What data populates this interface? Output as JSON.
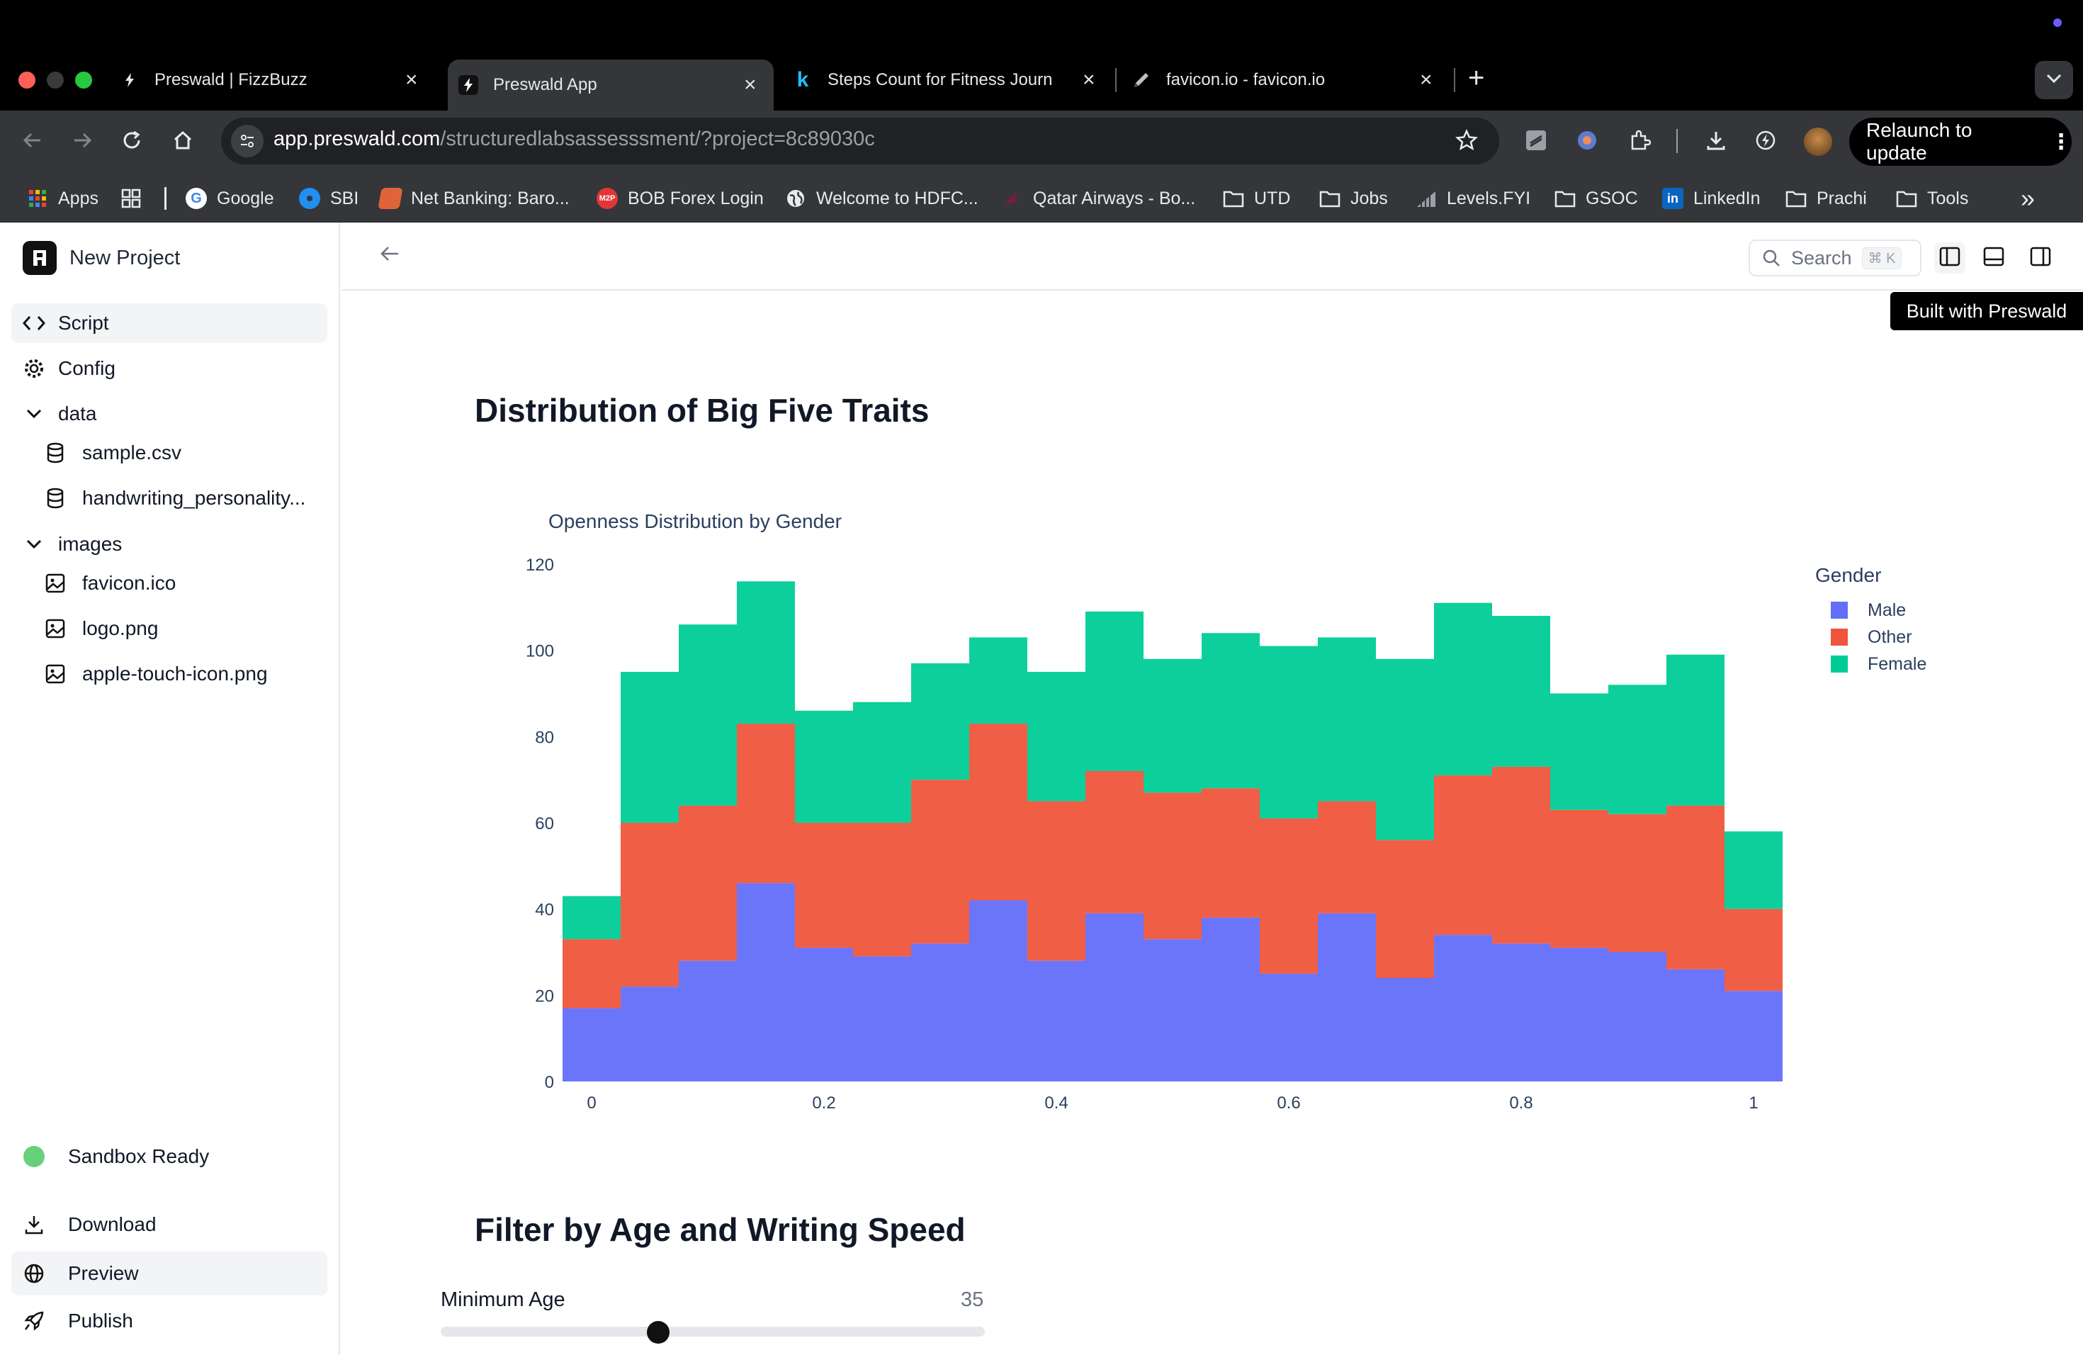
{
  "browser": {
    "tabs": [
      {
        "title": "Preswald | FizzBuzz",
        "icon": "preswald-icon",
        "active": false
      },
      {
        "title": "Preswald App",
        "icon": "preswald-icon",
        "active": true
      },
      {
        "title": "Steps Count for Fitness Journ",
        "icon": "k-icon",
        "active": false
      },
      {
        "title": "favicon.io - favicon.io",
        "icon": "pen-icon",
        "active": false
      }
    ],
    "new_tab_symbol": "+",
    "url_host": "app.preswald.com",
    "url_path": "/structuredlabsassesssment/?project=8c89030c",
    "relaunch_label": "Relaunch to update",
    "bookmarks": [
      {
        "label": "Apps",
        "icon": "apps-grid-icon"
      },
      {
        "label": "",
        "icon": "tab-grid-icon"
      },
      {
        "label": "Google",
        "icon": "google-icon"
      },
      {
        "label": "SBI",
        "icon": "sbi-icon"
      },
      {
        "label": "Net Banking: Baro...",
        "icon": "bank-icon"
      },
      {
        "label": "BOB Forex Login",
        "icon": "m2p-icon"
      },
      {
        "label": "Welcome to HDFC...",
        "icon": "globe-icon"
      },
      {
        "label": "Qatar Airways - Bo...",
        "icon": "airline-icon"
      },
      {
        "label": "UTD",
        "icon": "folder-icon"
      },
      {
        "label": "Jobs",
        "icon": "folder-icon"
      },
      {
        "label": "Levels.FYI",
        "icon": "chart-icon"
      },
      {
        "label": "GSOC",
        "icon": "folder-icon"
      },
      {
        "label": "LinkedIn",
        "icon": "linkedin-icon"
      },
      {
        "label": "Prachi",
        "icon": "folder-icon"
      },
      {
        "label": "Tools",
        "icon": "folder-icon"
      }
    ],
    "m2p_badge": "M2P",
    "linkedin_badge": "in",
    "more_bookmarks": "»"
  },
  "sidebar": {
    "project_name": "New Project",
    "items": {
      "script": "Script",
      "config": "Config",
      "data": "data",
      "sample": "sample.csv",
      "handwriting": "handwriting_personality...",
      "images": "images",
      "favicon": "favicon.ico",
      "logo": "logo.png",
      "apple": "apple-touch-icon.png"
    },
    "status": "Sandbox Ready",
    "download": "Download",
    "preview": "Preview",
    "publish": "Publish"
  },
  "header": {
    "search_label": "Search",
    "search_shortcut": "⌘ K",
    "tooltip": "Built with Preswald"
  },
  "main": {
    "heading1": "Distribution of Big Five Traits",
    "heading2": "Filter by Age and Writing Speed",
    "slider": {
      "label": "Minimum Age",
      "value": "35",
      "fraction": 0.4
    }
  },
  "chart_data": {
    "type": "bar",
    "stacked": true,
    "title": "Openness Distribution by Gender",
    "legend_title": "Gender",
    "legend_position": "top-right",
    "x_bin_edges": [
      0.0,
      0.05,
      0.1,
      0.15,
      0.2,
      0.25,
      0.3,
      0.35,
      0.4,
      0.45,
      0.5,
      0.55,
      0.6,
      0.65,
      0.7,
      0.75,
      0.8,
      0.85,
      0.9,
      0.95,
      1.0,
      1.05
    ],
    "x_range": [
      -0.025,
      1.025
    ],
    "x_ticks": [
      0,
      0.2,
      0.4,
      0.6,
      0.8,
      1
    ],
    "x_tick_labels": [
      "0",
      "0.2",
      "0.4",
      "0.6",
      "0.8",
      "1"
    ],
    "y_range": [
      0,
      120
    ],
    "y_ticks": [
      0,
      20,
      40,
      60,
      80,
      100,
      120
    ],
    "y_tick_labels": [
      "0",
      "20",
      "40",
      "60",
      "80",
      "100",
      "120"
    ],
    "series": [
      {
        "name": "Male",
        "color": "#636efa",
        "values": [
          17,
          22,
          28,
          46,
          31,
          29,
          32,
          42,
          28,
          39,
          33,
          38,
          25,
          39,
          24,
          34,
          32,
          31,
          30,
          26,
          21
        ]
      },
      {
        "name": "Other",
        "color": "#ef553b",
        "values": [
          16,
          38,
          36,
          37,
          29,
          31,
          38,
          41,
          37,
          33,
          34,
          30,
          36,
          26,
          32,
          37,
          41,
          32,
          32,
          38,
          19
        ]
      },
      {
        "name": "Female",
        "color": "#00cc96",
        "values": [
          10,
          35,
          42,
          33,
          26,
          28,
          27,
          20,
          30,
          37,
          31,
          36,
          40,
          38,
          42,
          40,
          35,
          27,
          30,
          35,
          18
        ]
      }
    ]
  }
}
